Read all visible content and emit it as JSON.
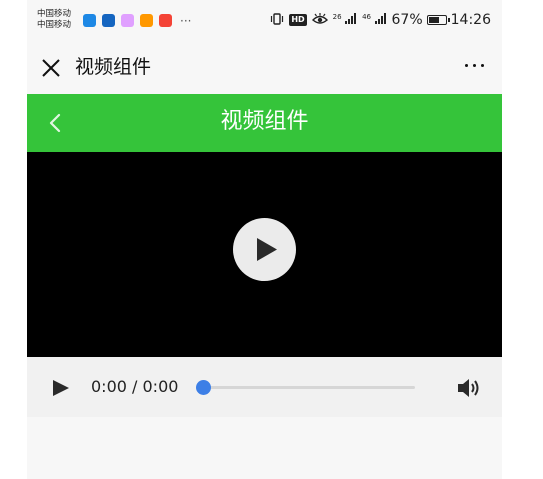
{
  "status_bar": {
    "carrier_line1": "中国移动",
    "carrier_line2": "中国移动",
    "notification_icons": [
      {
        "name": "message-app-icon",
        "color": "#1e88e5"
      },
      {
        "name": "browser-app-icon",
        "color": "#1565c0"
      },
      {
        "name": "photos-app-icon",
        "color": "#e0a0ff"
      },
      {
        "name": "location-app-icon",
        "color": "#ff9800"
      },
      {
        "name": "flame-app-icon",
        "color": "#f44336"
      }
    ],
    "more_indicator": "···",
    "hd_badge": "HD",
    "network_1": "26",
    "network_2": "46",
    "battery_percent": "67%",
    "battery_level": 0.67,
    "time": "14:26"
  },
  "nav_bar": {
    "title": "视频组件"
  },
  "header": {
    "title": "视频组件",
    "background": "#35c43a"
  },
  "video": {
    "background": "#000000"
  },
  "controls": {
    "time_display": "0:00 / 0:00",
    "progress": 0.0,
    "accent": "#3d7fe6"
  }
}
